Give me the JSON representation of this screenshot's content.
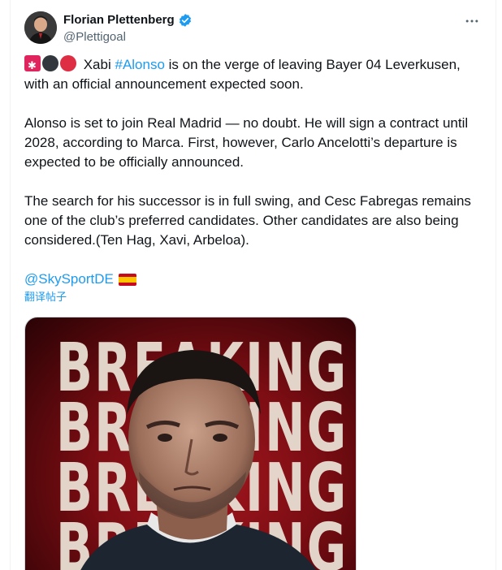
{
  "author": {
    "display_name": "Florian Plettenberg",
    "handle": "@Plettigoal",
    "verified": true
  },
  "tweet": {
    "para1_text": " Xabi ",
    "para1_hashtag": "#Alonso",
    "para1_rest": " is on the verge of leaving Bayer 04 Leverkusen, with an official announcement expected soon.",
    "para2": "Alonso is set to join Real Madrid — no doubt. He will sign a contract until 2028, according to Marca. First, however, Carlo Ancelotti’s departure is expected to be officially announced.",
    "para3": "The search for his successor is in full swing, and Cesc Fabregas remains one of the club’s preferred candidates. Other candidates are also being considered.(Ten Hag, Xavi, Arbeloa).",
    "mention": "@SkySportDE",
    "translate_label": "翻译帖子"
  },
  "media": {
    "headline_word": "BREAKING"
  },
  "icons": {
    "more": "more-options-icon",
    "verified": "verified-badge-icon",
    "siren": "siren-emoji",
    "black_circle": "black-circle-emoji",
    "red_circle": "red-circle-emoji",
    "spain_flag": "spain-flag-emoji"
  },
  "colors": {
    "accent": "#1d9bf0",
    "text": "#0f1419",
    "secondary": "#536471"
  }
}
